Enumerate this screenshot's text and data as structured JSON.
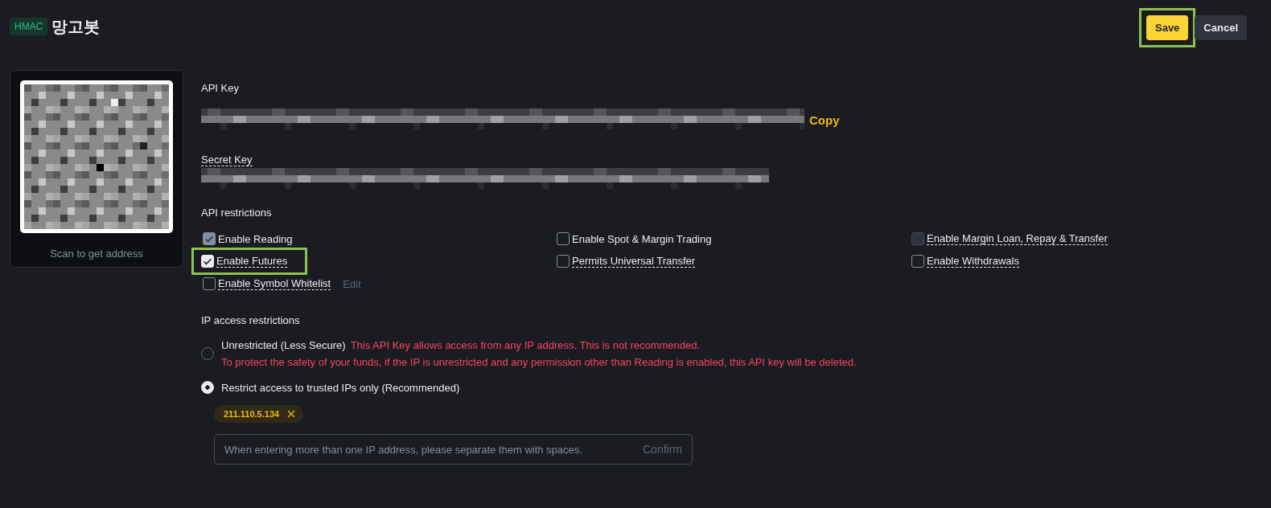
{
  "header": {
    "badge": "HMAC",
    "title": "망고봇"
  },
  "actions": [
    {
      "label": "Save",
      "kind": "primary",
      "highlighted": true
    },
    {
      "label": "Cancel",
      "kind": "secondary",
      "highlighted": false
    }
  ],
  "qr_card": {
    "caption": "Scan to get address"
  },
  "api_key": {
    "label": "API Key",
    "copy": "Copy"
  },
  "secret_key": {
    "label": "Secret Key"
  },
  "api_restrictions": {
    "title": "API restrictions",
    "options": [
      {
        "label": "Enable Reading",
        "checked": true,
        "disabled": true,
        "highlighted": false,
        "dashed": false
      },
      {
        "label": "Enable Spot & Margin Trading",
        "checked": false,
        "disabled": false,
        "highlighted": false,
        "dashed": false
      },
      {
        "label": "Enable Margin Loan, Repay & Transfer",
        "checked": false,
        "disabled": true,
        "highlighted": false,
        "dashed": true
      },
      {
        "label": "Enable Futures",
        "checked": true,
        "disabled": false,
        "highlighted": true,
        "dashed": true
      },
      {
        "label": "Permits Universal Transfer",
        "checked": false,
        "disabled": false,
        "highlighted": false,
        "dashed": true
      },
      {
        "label": "Enable Withdrawals",
        "checked": false,
        "disabled": false,
        "highlighted": false,
        "dashed": true
      },
      {
        "label": "Enable Symbol Whitelist",
        "checked": false,
        "disabled": false,
        "highlighted": false,
        "dashed": true,
        "edit": "Edit"
      }
    ]
  },
  "ip_restrictions": {
    "title": "IP access restrictions",
    "options": [
      {
        "label": "Unrestricted (Less Secure)",
        "selected": false,
        "warning": "This API Key allows access from any IP address. This is not recommended.",
        "warning_2": "To protect the safety of your funds, if the IP is unrestricted and any permission other than Reading is enabled, this API key will be deleted."
      },
      {
        "label": "Restrict access to trusted IPs only (Recommended)",
        "selected": true
      }
    ],
    "ips": [
      "211.110.5.134"
    ],
    "input": {
      "placeholder": "When entering more than one IP address, please separate them with spaces.",
      "confirm": "Confirm"
    }
  }
}
